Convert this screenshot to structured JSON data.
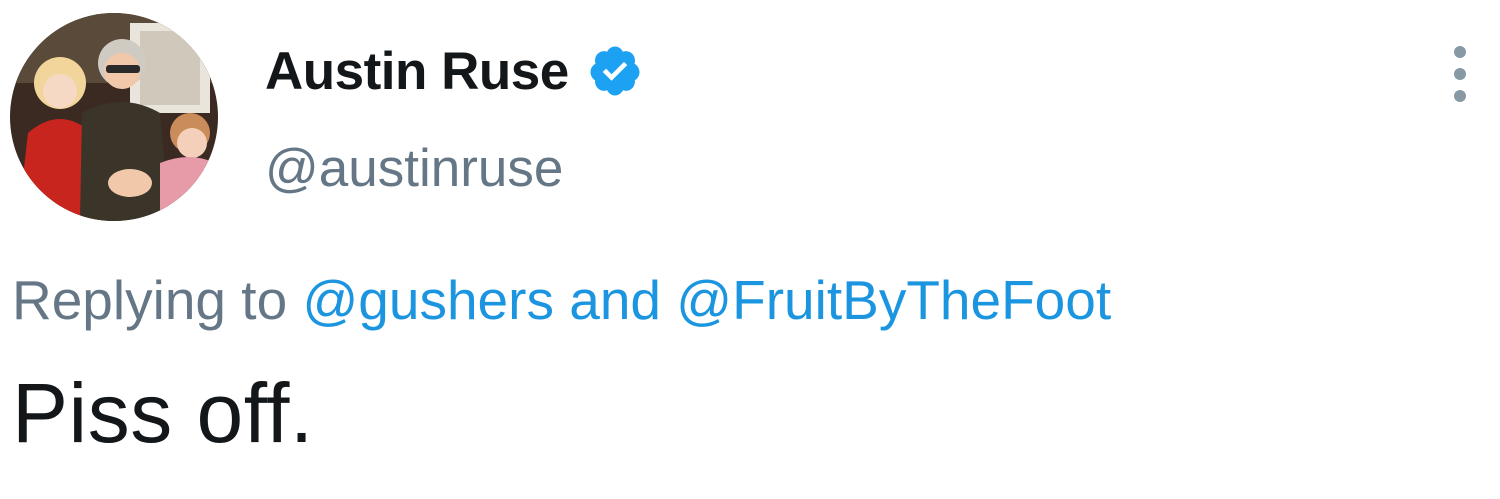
{
  "author": {
    "display_name": "Austin Ruse",
    "handle": "@austinruse",
    "verified": true,
    "avatar_icon": "profile-photo-avatar"
  },
  "reply": {
    "prefix": "Replying to",
    "mention_1": "@gushers",
    "conjunction": "and",
    "mention_2": "@FruitByTheFoot"
  },
  "tweet": {
    "text": "Piss off."
  },
  "icons": {
    "verified": "verified-badge-icon",
    "more": "more-options-icon"
  },
  "colors": {
    "text": "#14171a",
    "secondary": "#657786",
    "link": "#1b95e0",
    "verified": "#1da1f2"
  }
}
